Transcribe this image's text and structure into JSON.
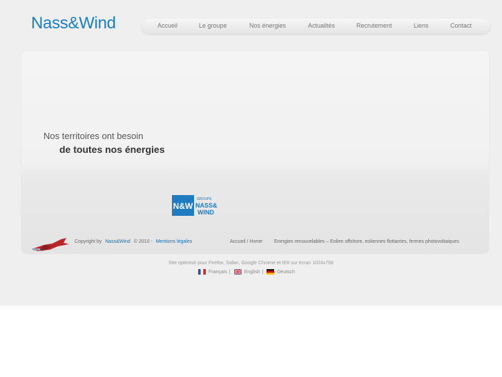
{
  "brand": {
    "name": "Nass&Wind"
  },
  "nav": {
    "items": [
      {
        "label": "Accueil"
      },
      {
        "label": "Le groupe"
      },
      {
        "label": "Nos énergies"
      },
      {
        "label": "Actualités"
      },
      {
        "label": "Recrutement"
      },
      {
        "label": "Liens"
      },
      {
        "label": "Contact"
      }
    ]
  },
  "hero": {
    "line1": "Nos territoires ont besoin",
    "line2": "de toutes nos énergies"
  },
  "group_logo": {
    "top": "GROUPE",
    "line1": "NASS&",
    "line2": "WIND",
    "mark": "N&W"
  },
  "footer": {
    "copyright_prefix": "Copyright by",
    "copyright_brand": "Nass&Wind",
    "copyright_year": "© 2010 -",
    "legal": "Mentions légales",
    "home": "Accueil / Home",
    "tagline": "Energies renouvelables – Eolien offshore, eoliennes flottantes, fermes photovoltaiques"
  },
  "optimized_note": "Site optimisé pour Firefox, Safari, Google Chrome et IE8 sur écran 1024x768",
  "languages": [
    {
      "label": "Français",
      "flag": "flag-fr-icon"
    },
    {
      "label": "English",
      "flag": "flag-uk-icon"
    },
    {
      "label": "Deutsch",
      "flag": "flag-de-icon"
    }
  ],
  "colors": {
    "brand_blue": "#1a7fc4",
    "link_blue": "#1a6fb4",
    "background": "#efefef"
  }
}
